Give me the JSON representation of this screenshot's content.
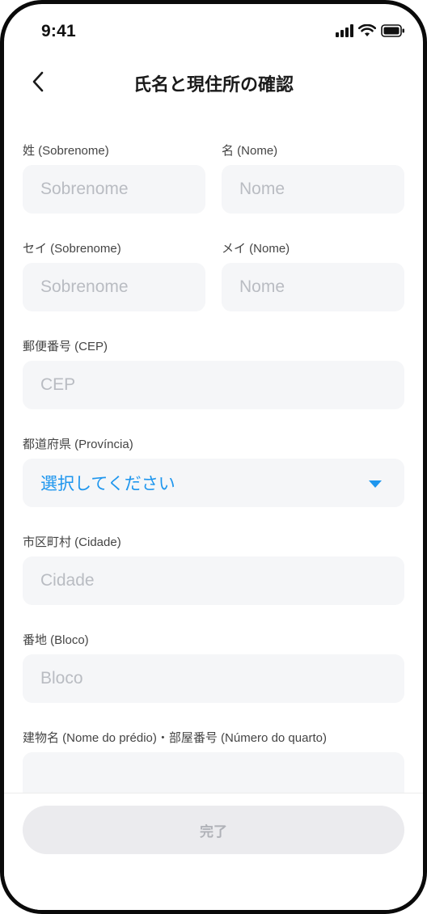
{
  "status_bar": {
    "time": "9:41"
  },
  "header": {
    "title": "氏名と現住所の確認"
  },
  "form": {
    "last_name": {
      "label": "姓 (Sobrenome)",
      "placeholder": "Sobrenome"
    },
    "first_name": {
      "label": "名 (Nome)",
      "placeholder": "Nome"
    },
    "last_name_kana": {
      "label": "セイ (Sobrenome)",
      "placeholder": "Sobrenome"
    },
    "first_name_kana": {
      "label": "メイ (Nome)",
      "placeholder": "Nome"
    },
    "postal_code": {
      "label": "郵便番号 (CEP)",
      "placeholder": "CEP"
    },
    "prefecture": {
      "label": "都道府県 (Província)",
      "value": "選択してください"
    },
    "city": {
      "label": "市区町村 (Cidade)",
      "placeholder": "Cidade"
    },
    "block": {
      "label": "番地 (Bloco)",
      "placeholder": "Bloco"
    },
    "building": {
      "label": "建物名 (Nome do prédio)・部屋番号 (Número do quarto)",
      "placeholder": ""
    }
  },
  "footer": {
    "done_label": "完了"
  },
  "colors": {
    "accent": "#1e96ee",
    "field_bg": "#f5f6f8",
    "placeholder": "#b9bcc2",
    "button_disabled_bg": "#ebebee"
  }
}
